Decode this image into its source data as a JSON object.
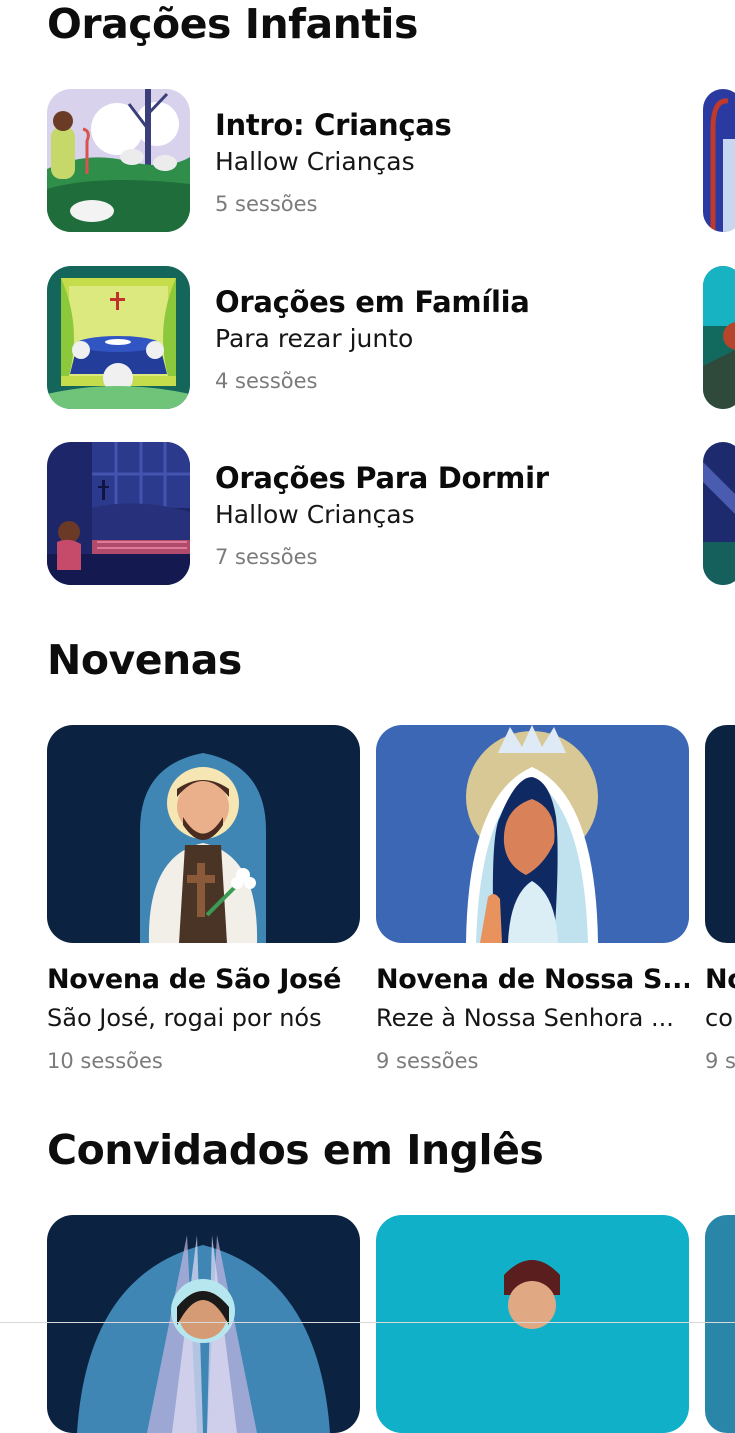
{
  "sections": {
    "kids": {
      "title": "Orações Infantis",
      "items": [
        {
          "title": "Intro: Crianças",
          "subtitle": "Hallow Crianças",
          "sessions": "5 sessões",
          "icon": "shepherd-sheep-art"
        },
        {
          "title": "Orações em Família",
          "subtitle": "Para rezar junto",
          "sessions": "4 sessões",
          "icon": "family-table-art"
        },
        {
          "title": "Orações Para Dormir",
          "subtitle": "Hallow Crianças",
          "sessions": "7 sessões",
          "icon": "bedtime-prayer-art"
        }
      ]
    },
    "novenas": {
      "title": "Novenas",
      "cards": [
        {
          "title": "Novena de São José",
          "subtitle": "São José, rogai por nós",
          "sessions": "10 sessões",
          "icon": "saint-joseph-art"
        },
        {
          "title": "Novena de Nossa S...",
          "subtitle": "Reze à Nossa Senhora ...",
          "sessions": "9 sessões",
          "icon": "our-lady-art"
        },
        {
          "title": "No",
          "subtitle": "co",
          "sessions": "9 s",
          "icon": "novena-art"
        }
      ]
    },
    "guests": {
      "title": "Convidados em Inglês"
    }
  },
  "colors": {
    "navy": "#0b2240",
    "blue": "#3b67b5",
    "teal": "#10b1c8",
    "meta_gray": "#7b7b7b"
  }
}
